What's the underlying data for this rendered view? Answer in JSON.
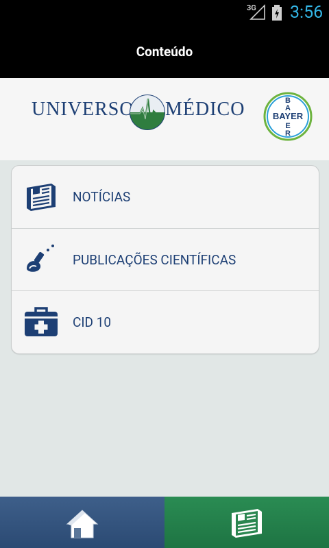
{
  "status_bar": {
    "network": "3G",
    "time": "3:56"
  },
  "action_bar": {
    "title": "Conteúdo"
  },
  "header": {
    "brand_left": "UNIVERSO",
    "brand_right": "MÉDICO",
    "partner_text": "BAYER"
  },
  "menu": {
    "items": [
      {
        "label": "NOTÍCIAS",
        "icon": "newspaper-icon"
      },
      {
        "label": "PUBLICAÇÕES CIENTÍFICAS",
        "icon": "microscope-icon"
      },
      {
        "label": "CID 10",
        "icon": "first-aid-kit-icon"
      }
    ]
  },
  "bottom_nav": {
    "tabs": [
      {
        "name": "home",
        "icon": "home-icon",
        "active": false
      },
      {
        "name": "content",
        "icon": "newspaper-icon",
        "active": true
      }
    ]
  },
  "colors": {
    "brand_blue": "#1d3f74",
    "status_accent": "#33b5e5",
    "home_tab": "#2f4f7a",
    "content_tab": "#237f49"
  }
}
